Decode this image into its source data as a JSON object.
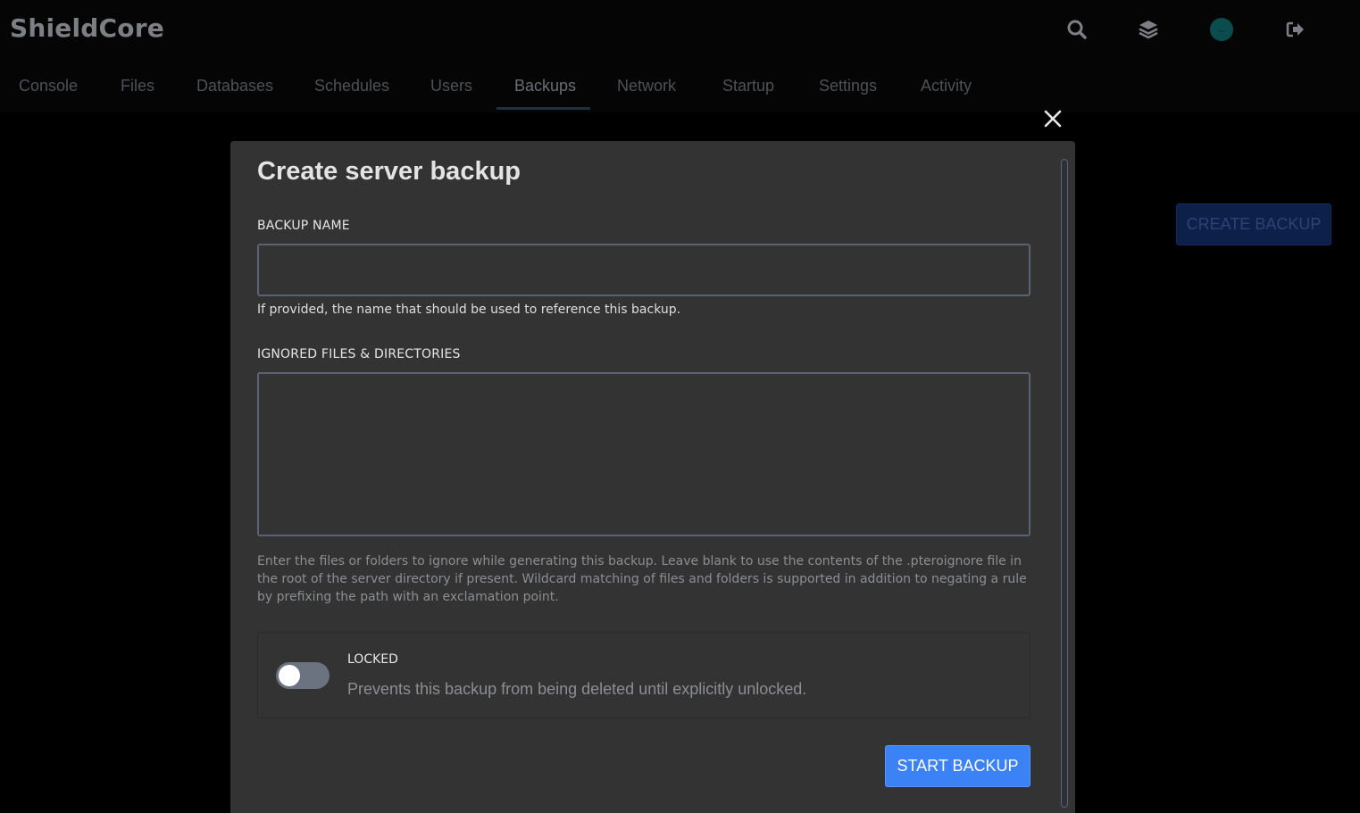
{
  "app": {
    "brand": "ShieldCore"
  },
  "header_icons": [
    "search-icon",
    "layers-icon",
    "avatar",
    "logout-icon"
  ],
  "nav": {
    "items": [
      {
        "label": "Console"
      },
      {
        "label": "Files"
      },
      {
        "label": "Databases"
      },
      {
        "label": "Schedules"
      },
      {
        "label": "Users"
      },
      {
        "label": "Backups"
      },
      {
        "label": "Network"
      },
      {
        "label": "Startup"
      },
      {
        "label": "Settings"
      },
      {
        "label": "Activity"
      }
    ],
    "active": "Backups"
  },
  "page": {
    "create_backup_label": "CREATE BACKUP"
  },
  "modal": {
    "title": "Create server backup",
    "backup_name": {
      "label": "BACKUP NAME",
      "value": "",
      "help": "If provided, the name that should be used to reference this backup."
    },
    "ignored": {
      "label": "IGNORED FILES & DIRECTORIES",
      "value": "",
      "help": "Enter the files or folders to ignore while generating this backup. Leave blank to use the contents of the .pteroignore file in the root of the server directory if present. Wildcard matching of files and folders is supported in addition to negating a rule by prefixing the path with an exclamation point."
    },
    "locked": {
      "title": "LOCKED",
      "description": "Prevents this backup from being deleted until explicitly unlocked.",
      "enabled": false
    },
    "start_label": "START BACKUP"
  },
  "colors": {
    "accent": "#3b82f6",
    "modal_bg": "#333333",
    "page_bg": "#000000"
  }
}
